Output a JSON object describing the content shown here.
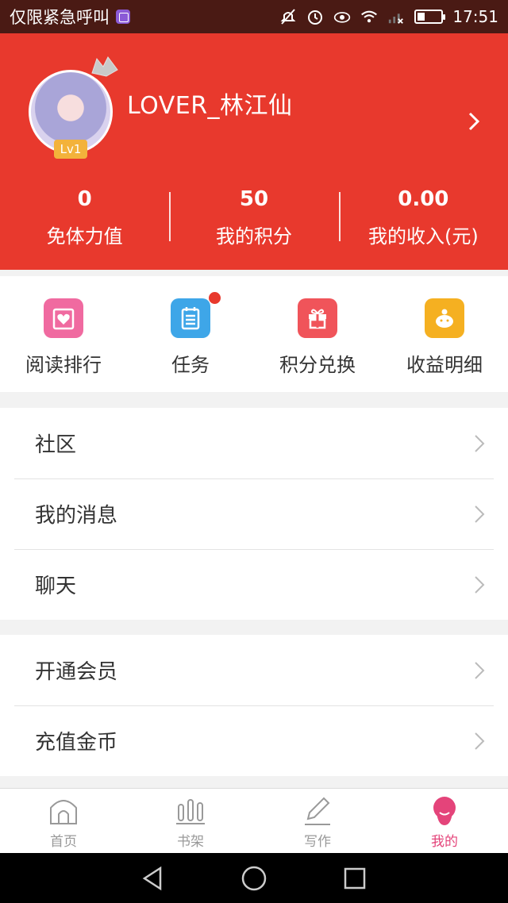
{
  "status_bar": {
    "carrier": "仅限紧急呼叫",
    "time": "17:51"
  },
  "profile": {
    "username": "LOVER_林江仙",
    "level": "Lv1"
  },
  "stats": [
    {
      "value": "0",
      "label": "免体力值"
    },
    {
      "value": "50",
      "label": "我的积分"
    },
    {
      "value": "0.00",
      "label": "我的收入(元)"
    }
  ],
  "quick_menu": [
    {
      "label": "阅读排行",
      "icon": "heart-envelope-icon",
      "color": "#f06aa0"
    },
    {
      "label": "任务",
      "icon": "task-list-icon",
      "color": "#3ea6e8",
      "has_badge": true
    },
    {
      "label": "积分兑换",
      "icon": "gift-icon",
      "color": "#f0545a"
    },
    {
      "label": "收益明细",
      "icon": "piggy-bank-icon",
      "color": "#f5b021"
    }
  ],
  "list_group_1": [
    {
      "label": "社区"
    },
    {
      "label": "我的消息"
    },
    {
      "label": "聊天"
    }
  ],
  "list_group_2": [
    {
      "label": "开通会员"
    },
    {
      "label": "充值金币"
    }
  ],
  "tabs": [
    {
      "label": "首页",
      "icon": "home-icon"
    },
    {
      "label": "书架",
      "icon": "bookshelf-icon"
    },
    {
      "label": "写作",
      "icon": "pencil-icon"
    },
    {
      "label": "我的",
      "icon": "profile-icon",
      "active": true
    }
  ],
  "colors": {
    "header_bg": "#e8392d",
    "accent_pink": "#e4447a",
    "status_bar_bg": "#4a1a14"
  }
}
